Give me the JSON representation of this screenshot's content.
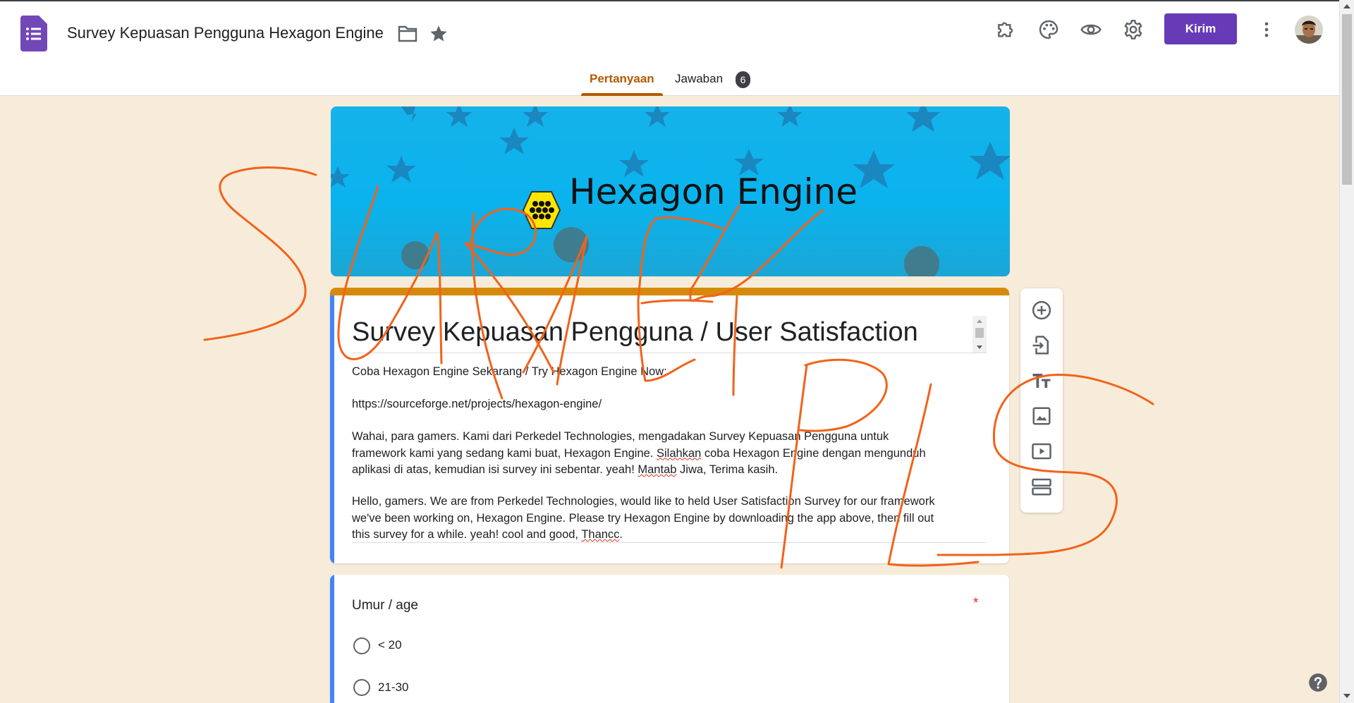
{
  "header": {
    "doc_title": "Survey Kepuasan Pengguna Hexagon Engine",
    "send_label": "Kirim",
    "icons": [
      "forms-logo-icon",
      "folder-icon",
      "star-icon",
      "addon-puzzle-icon",
      "palette-icon",
      "preview-eye-icon",
      "settings-gear-icon",
      "more-vert-icon",
      "avatar"
    ],
    "tabs": [
      {
        "label": "Pertanyaan",
        "active": true
      },
      {
        "label": "Jawaban",
        "badge": "6"
      }
    ],
    "accent_color": "#673ab7",
    "theme_color": "#b35900"
  },
  "banner": {
    "title": "Hexagon Engine"
  },
  "form": {
    "title": "Survey Kepuasan Pengguna / User Satisfaction",
    "description": {
      "line1": "Coba Hexagon Engine Sekarang / Try Hexagon Engine Now:",
      "line2": "https://sourceforge.net/projects/hexagon-engine/",
      "p1a": "Wahai, para gamers. Kami dari Perkedel Technologies, mengadakan Survey Kepuasan Pengguna untuk",
      "p1b_1": "framework kami yang sedang kami buat, Hexagon Engine. ",
      "p1b_sq": "Silahkan",
      "p1b_2": " coba Hexagon Engine dengan mengunduh",
      "p1c_1": "aplikasi di atas, kemudian isi survey ini sebentar. yeah! ",
      "p1c_sq": "Mantab",
      "p1c_2": " Jiwa, Terima kasih.",
      "p2a": "Hello, gamers. We are from Perkedel Technologies, would like to held User Satisfaction Survey for our framework",
      "p2b": "we've been working on, Hexagon Engine. Please try Hexagon Engine by downloading the app above, then fill out",
      "p2c_1": "this survey for a while. yeah! cool and good, ",
      "p2c_sq": "Thancc",
      "p2c_2": "."
    }
  },
  "side_toolbar": [
    "add-question-icon",
    "import-questions-icon",
    "add-title-icon",
    "add-image-icon",
    "add-video-icon",
    "add-section-icon"
  ],
  "question": {
    "title": "Umur / age",
    "required_mark": "*",
    "options": [
      "< 20",
      "21-30"
    ]
  },
  "overlay_handwriting": "SURVEY PLS",
  "overlay_color": "#f2621a"
}
